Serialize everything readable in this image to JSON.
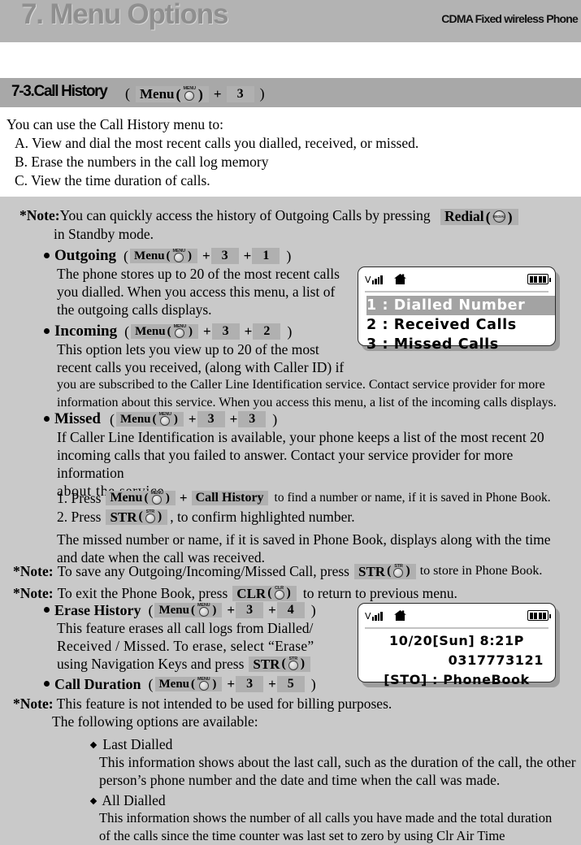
{
  "header": {
    "chapter_title": "7. Menu Options",
    "product_label": "CDMA Fixed wireless Phone"
  },
  "section": {
    "title": "7-3.Call History",
    "key_menu_label": "Menu",
    "key_menu_cap": "MENU",
    "key_plus": "+",
    "key_3": "3",
    "paren_open": "(",
    "paren_close": ")"
  },
  "intro": {
    "lead": "You can use the Call History menu to:",
    "items": [
      "A. View and dial the most recent calls you dialled, received, or missed.",
      "B. Erase the numbers in the call log memory",
      "C. View the time duration of calls."
    ]
  },
  "note_redial": {
    "label": "*Note:",
    "text": "You can quickly access the history of Outgoing Calls by pressing",
    "key_redial_label": "Redial",
    "key_redial_cap": "REDIAL",
    "text2": "in Standby mode."
  },
  "outgoing": {
    "title": "Outgoing",
    "keys": {
      "menu": "Menu",
      "menu_cap": "MENU",
      "a": "3",
      "b": "1"
    },
    "body": [
      "The phone stores up to 20 of the most recent calls",
      "you dialled. When you access this menu, a list of",
      "the outgoing calls displays."
    ]
  },
  "incoming": {
    "title": "Incoming",
    "keys": {
      "menu": "Menu",
      "menu_cap": "MENU",
      "a": "3",
      "b": "2"
    },
    "body_narrow": [
      "This option lets you view up to 20 of the most",
      "recent calls you received, (along with Caller ID) if"
    ],
    "body_wide": [
      "you are subscribed to the Caller Line Identification service. Contact service provider for more",
      "information about this service. When you access this menu, a list of the incoming calls displays."
    ]
  },
  "missed": {
    "title": "Missed",
    "keys": {
      "menu": "Menu",
      "menu_cap": "MENU",
      "a": "3",
      "b": "3"
    },
    "body": [
      "If Caller Line Identification is available, your phone keeps a list of the most recent 20",
      "incoming calls that you failed to answer. Contact your service provider for more information",
      "about the service."
    ],
    "step1_pre": "1. Press",
    "step1_menu": "Menu",
    "step1_menu_cap": "MENU",
    "step1_plus": "+",
    "step1_callhistory": "Call History",
    "step1_post": "to find a number or name, if it is saved in Phone Book.",
    "step2_pre": "2. Press",
    "step2_key": "STR",
    "step2_key_cap": "STR",
    "step2_post": ", to confirm highlighted number.",
    "tail": [
      "The missed number or name,  if it is saved in Phone Book, displays along with the time",
      "and date when the call was received."
    ]
  },
  "note_save": {
    "label": "*Note:",
    "pre": "To save any Outgoing/Incoming/Missed Call, press",
    "key": "STR",
    "key_cap": "STR",
    "post": "to store in Phone Book."
  },
  "note_exit": {
    "label": "*Note:",
    "pre": "To exit the Phone Book, press",
    "key": "CLR",
    "key_cap": "CLR",
    "post": "to return to previous menu."
  },
  "erase_history": {
    "title": "Erase History",
    "keys": {
      "menu": "Menu",
      "menu_cap": "MENU",
      "a": "3",
      "b": "4"
    },
    "body": [
      "This feature erases all call logs from Dialled/",
      "Received / Missed. To erase, select “Erase”"
    ],
    "body_last_pre": "using Navigation Keys and press",
    "body_last_key": "STR",
    "body_last_key_cap": "STR"
  },
  "call_duration": {
    "title": "Call Duration",
    "keys": {
      "menu": "Menu",
      "menu_cap": "MENU",
      "a": "3",
      "b": "5"
    },
    "note_label": "*Note:",
    "note_text": "This feature is not intended to be used for billing purposes.",
    "options_lead": "The following options are available:",
    "options": [
      {
        "name": "Last Dialled",
        "lines": [
          "This information shows about the last call, such as the duration of the call, the other",
          "person’s  phone number and the date and time when the call was made."
        ]
      },
      {
        "name": "All Dialled",
        "lines": [
          "This information shows the number of all calls you have made and the total duration",
          "of the calls since the time counter was last set to zero by using Clr Air Time"
        ]
      }
    ]
  },
  "lcd1": {
    "status": {
      "signal_icon": "signal-bars-icon",
      "home_icon": "home-icon",
      "battery_icon": "battery-icon"
    },
    "rows": [
      {
        "text": "1 : Dialled Number",
        "highlighted": true
      },
      {
        "text": "2 : Received Calls",
        "highlighted": false
      },
      {
        "text": "3 : Missed Calls",
        "highlighted": false
      }
    ]
  },
  "lcd2": {
    "status": {
      "signal_icon": "signal-bars-icon",
      "home_icon": "home-icon",
      "battery_icon": "battery-icon"
    },
    "row1": "10/20[Sun]   8:21P",
    "row2": "0317773121",
    "row3": "[STO] :   PhoneBook"
  },
  "colors": {
    "chapter_bar": "#b3b3b3",
    "section_bar": "#a8a8a8",
    "body_bg": "#c9c9c9",
    "key_bg": "#b0b0b0",
    "lcd_highlight": "#a3a3a3"
  }
}
